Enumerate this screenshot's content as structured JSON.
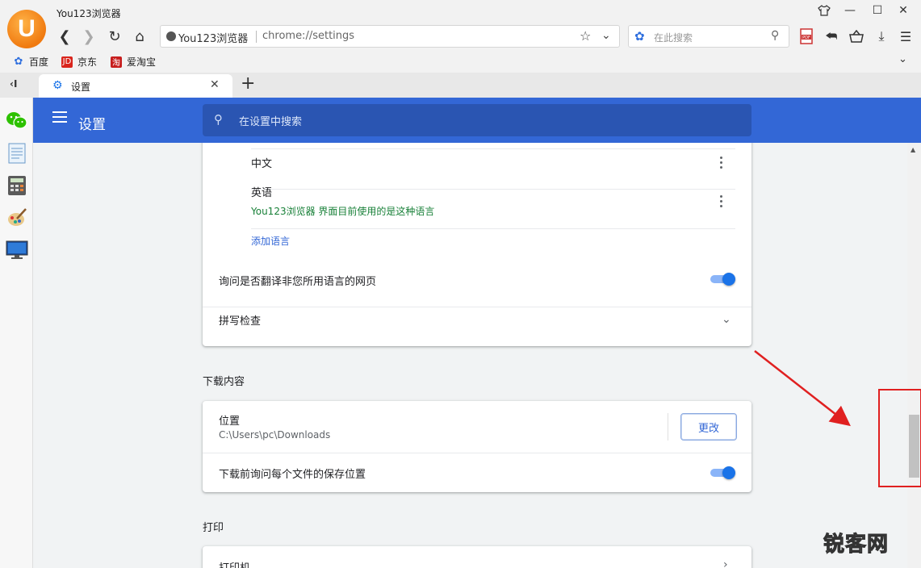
{
  "window": {
    "title": "You123浏览器",
    "logo_letter": "U"
  },
  "address_bar": {
    "site_name": "You123浏览器",
    "url": "chrome://settings"
  },
  "search_box": {
    "placeholder": "在此搜索"
  },
  "bookmarks": [
    {
      "label": "百度",
      "icon": "baidu-paw-icon"
    },
    {
      "label": "京东",
      "icon": "jd-logo-icon",
      "badge": "JD"
    },
    {
      "label": "爱淘宝",
      "icon": "taobao-logo-icon",
      "badge": "淘"
    }
  ],
  "tabs": [
    {
      "label": "设置",
      "icon": "gear-icon",
      "active": true
    }
  ],
  "settings": {
    "header_title": "设置",
    "search_placeholder": "在设置中搜索"
  },
  "languages": {
    "items": [
      {
        "name": "中文",
        "note": ""
      },
      {
        "name": "英语",
        "note": "You123浏览器 界面目前使用的是这种语言"
      }
    ],
    "add_link": "添加语言",
    "translate_prompt": "询问是否翻译非您所用语言的网页",
    "translate_enabled": true,
    "spellcheck": "拼写检查"
  },
  "downloads": {
    "section_title": "下载内容",
    "location_label": "位置",
    "location_path": "C:\\Users\\pc\\Downloads",
    "change_button": "更改",
    "ask_label": "下载前询问每个文件的保存位置",
    "ask_enabled": true
  },
  "printing": {
    "section_title": "打印",
    "printers_label": "打印机"
  },
  "watermark": {
    "text": "锐客网"
  },
  "colors": {
    "header_blue": "#3367d6",
    "toggle_blue": "#1a73e8",
    "link_blue": "#3367d6",
    "note_green": "#188038",
    "annotation_red": "#e02020"
  }
}
